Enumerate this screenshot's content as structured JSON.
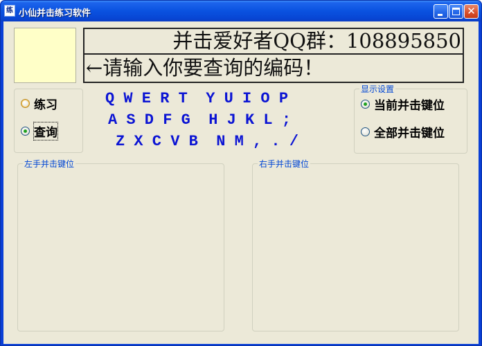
{
  "window": {
    "title": "小仙并击练习软件",
    "icon_text": "练"
  },
  "banner": {
    "line1": "并击爱好者QQ群：108895850",
    "line2": "←请输入你要查询的编码！"
  },
  "mode": {
    "options": [
      {
        "label": "练习",
        "checked": false
      },
      {
        "label": "查询",
        "checked": true
      }
    ]
  },
  "keyboard": {
    "rows": [
      "Q W E R T  Y U I O P",
      "A S D F G  H J K L ;",
      "Z X C V B  N M , . /"
    ]
  },
  "display_settings": {
    "title": "显示设置",
    "options": [
      {
        "label": "当前并击键位",
        "checked": true
      },
      {
        "label": "全部并击键位",
        "checked": false
      }
    ]
  },
  "left_hand": {
    "title": "左手并击键位"
  },
  "right_hand": {
    "title": "右手并击键位"
  },
  "colors": {
    "title_bar": "#0a52e0",
    "client_bg": "#ece9d8",
    "key_text": "#0b14d4",
    "group_title": "#0046d5",
    "highlight_box": "#ffffc8"
  },
  "icons": [
    "app-icon",
    "minimize-icon",
    "maximize-icon",
    "close-icon"
  ]
}
